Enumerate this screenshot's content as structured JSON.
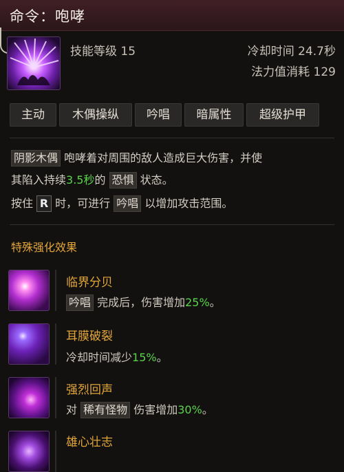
{
  "header": {
    "title": "命令：咆哮"
  },
  "skill": {
    "level_label": "技能等级 15",
    "cooldown_label": "冷却时间 24.7秒",
    "mana_label": "法力值消耗 129"
  },
  "tags": [
    "主动",
    "木偶操纵",
    "吟唱",
    "暗属性",
    "超级护甲"
  ],
  "description": {
    "line1_kw": "阴影木偶",
    "line1_text": " 咆哮着对周围的敌人造成巨大伤害，并使",
    "line2_a": "其陷入持续",
    "line2_value": "3.5秒",
    "line2_b": "的 ",
    "line2_kw": "恐惧",
    "line2_c": " 状态。",
    "line3_a": "按住 ",
    "line3_key": "R",
    "line3_b": " 时，可进行 ",
    "line3_kw": "吟唱",
    "line3_c": " 以增加攻击范围。"
  },
  "special": {
    "title": "特殊强化效果",
    "perks": [
      {
        "name": "临界分贝",
        "kw": "吟唱",
        "text_a": " 完成后，伤害增加",
        "value": "25%",
        "text_b": "。"
      },
      {
        "name": "耳膜破裂",
        "kw": "",
        "text_a": "冷却时间减少",
        "value": "15%",
        "text_b": "。"
      },
      {
        "name": "强烈回声",
        "kw_pre": "对 ",
        "kw": "稀有怪物",
        "text_a": " 伤害增加",
        "value": "30%",
        "text_b": "。"
      },
      {
        "name": "雄心壮志"
      }
    ]
  },
  "colors": {
    "accent_orange": "#e3a63a",
    "value_green": "#5ad34b",
    "header_bg": "#3f1f25"
  }
}
